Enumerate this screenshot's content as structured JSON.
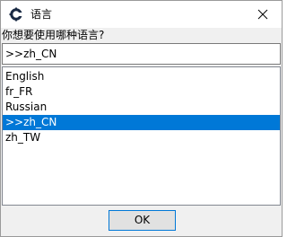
{
  "window": {
    "title": "语言",
    "prompt": "你想要使用哪种语言?",
    "icon": "gear-icon",
    "close_icon": "close-icon"
  },
  "input": {
    "value": ">>zh_CN"
  },
  "list": {
    "items": [
      {
        "label": "English",
        "selected": false
      },
      {
        "label": "fr_FR",
        "selected": false
      },
      {
        "label": "Russian",
        "selected": false
      },
      {
        "label": ">>zh_CN",
        "selected": true
      },
      {
        "label": "zh_TW",
        "selected": false
      }
    ]
  },
  "buttons": {
    "ok_label": "OK"
  },
  "colors": {
    "selection": "#0078d7",
    "button_border": "#0078d7"
  }
}
